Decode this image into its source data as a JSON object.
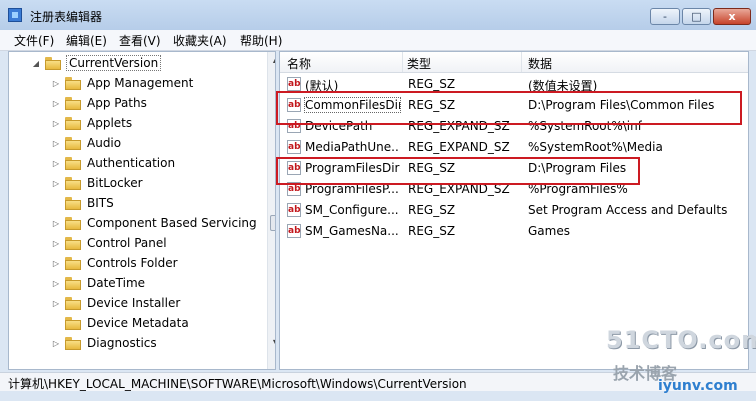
{
  "window": {
    "title": "注册表编辑器"
  },
  "menu": [
    "文件(F)",
    "编辑(E)",
    "查看(V)",
    "收藏夹(A)",
    "帮助(H)"
  ],
  "tree": {
    "root": "CurrentVersion",
    "children": [
      "App Management",
      "App Paths",
      "Applets",
      "Audio",
      "Authentication",
      "BitLocker",
      "BITS",
      "Component Based Servicing",
      "Control Panel",
      "Controls Folder",
      "DateTime",
      "Device Installer",
      "Device Metadata",
      "Diagnostics"
    ]
  },
  "list": {
    "columns": [
      "名称",
      "类型",
      "数据"
    ],
    "rows": [
      {
        "name": "(默认)",
        "type": "REG_SZ",
        "data": "(数值未设置)"
      },
      {
        "name": "CommonFilesDir",
        "type": "REG_SZ",
        "data": "D:\\Program Files\\Common Files"
      },
      {
        "name": "DevicePath",
        "type": "REG_EXPAND_SZ",
        "data": "%SystemRoot%\\inf"
      },
      {
        "name": "MediaPathUne...",
        "type": "REG_EXPAND_SZ",
        "data": "%SystemRoot%\\Media"
      },
      {
        "name": "ProgramFilesDir",
        "type": "REG_SZ",
        "data": "D:\\Program Files"
      },
      {
        "name": "ProgramFilesP...",
        "type": "REG_EXPAND_SZ",
        "data": "%ProgramFiles%"
      },
      {
        "name": "SM_Configure...",
        "type": "REG_SZ",
        "data": "Set Program Access and Defaults"
      },
      {
        "name": "SM_GamesNa...",
        "type": "REG_SZ",
        "data": "Games"
      }
    ],
    "highlight_color": "#cc1a22"
  },
  "status": {
    "path": "计算机\\HKEY_LOCAL_MACHINE\\SOFTWARE\\Microsoft\\Windows\\CurrentVersion"
  },
  "watermark": {
    "line1": "51CTO.com",
    "line2": "技术博客",
    "line3": "iyunv.com"
  },
  "icons": {
    "value": "ab",
    "window_min": "-",
    "window_max": "□",
    "window_close": "x"
  }
}
